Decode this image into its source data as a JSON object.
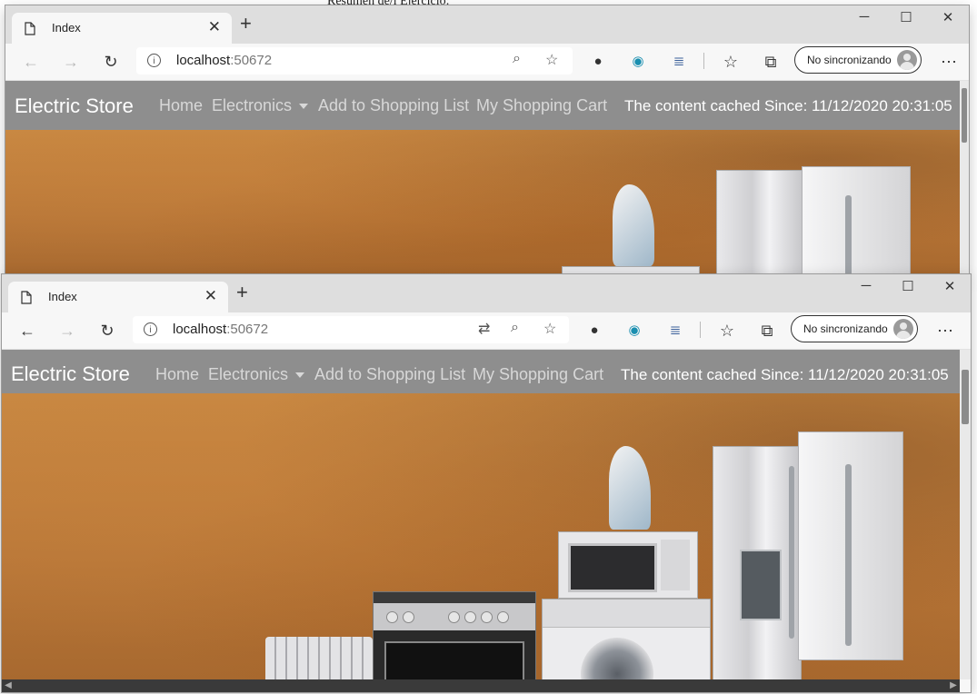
{
  "background_document": {
    "text": "Resumen de/l Ejercicio:"
  },
  "browser": {
    "tab_title": "Index",
    "address_host": "localhost",
    "address_port": ":50672",
    "sync_label": "No sincronizando",
    "window_controls": {
      "minimize": "─",
      "maximize": "☐",
      "close": "✕"
    },
    "icons": [
      "back-icon",
      "forward-icon",
      "refresh-icon",
      "info-icon",
      "translate-icon",
      "zoom-icon",
      "favorite-star-icon",
      "lightbulb-extension-icon",
      "record-extension-icon",
      "stack-extension-icon",
      "favorites-list-icon",
      "collections-icon",
      "more-icon"
    ]
  },
  "site": {
    "brand": "Electric Store",
    "nav": {
      "home": "Home",
      "electronics": "Electronics",
      "add_list": "Add to Shopping List",
      "cart": "My Shopping Cart"
    },
    "cached_text": "The content cached Since: 11/12/2020 20:31:05"
  },
  "colors": {
    "navbar": "#8e8e8e",
    "hero_wall": "#c98a44",
    "titlebar": "#dedede"
  }
}
